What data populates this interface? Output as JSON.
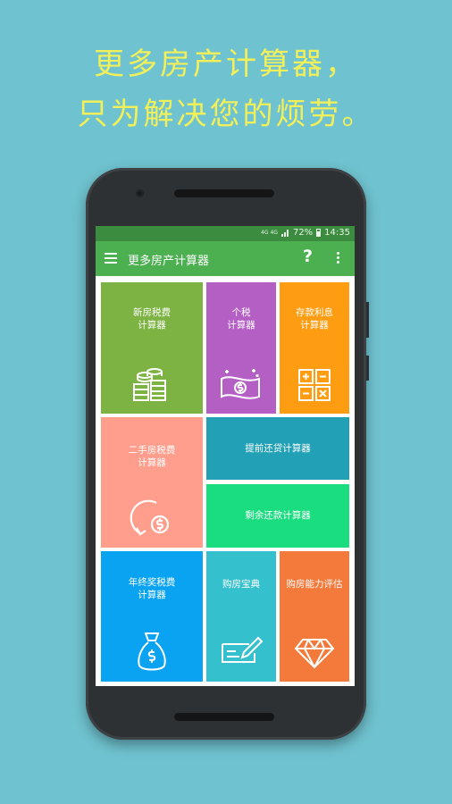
{
  "promo": {
    "line1": "更多房产计算器，",
    "line2": "只为解决您的烦劳。"
  },
  "statusbar": {
    "network": "4G 4G",
    "battery": "72%",
    "time": "14:35"
  },
  "appbar": {
    "title": "更多房产计算器",
    "help": "?"
  },
  "tiles": [
    {
      "id": "newhouse",
      "line1": "新房税费",
      "line2": "计算器",
      "icon": "coins-icon",
      "color": "#7cb342"
    },
    {
      "id": "personal",
      "line1": "个税",
      "line2": "计算器",
      "icon": "banknote-icon",
      "color": "#b45fc4"
    },
    {
      "id": "deposit",
      "line1": "存款利息",
      "line2": "计算器",
      "icon": "calculator-icon",
      "color": "#ff9d12"
    },
    {
      "id": "second",
      "line1": "二手房税费",
      "line2": "计算器",
      "icon": "dollar-cycle-icon",
      "color": "#ff9e8c"
    },
    {
      "id": "prepay",
      "line1": "提前还贷计算器",
      "color": "#22a1b6"
    },
    {
      "id": "remain",
      "line1": "剩余还款计算器",
      "color": "#19dd7f"
    },
    {
      "id": "bonus",
      "line1": "年终奖税费",
      "line2": "计算器",
      "icon": "money-bag-icon",
      "color": "#0aa3f2"
    },
    {
      "id": "guide",
      "line1": "购房宝典",
      "icon": "pen-document-icon",
      "color": "#35c0cd"
    },
    {
      "id": "ability",
      "line1": "购房能力评估",
      "icon": "diamond-icon",
      "color": "#f47a3b"
    }
  ]
}
